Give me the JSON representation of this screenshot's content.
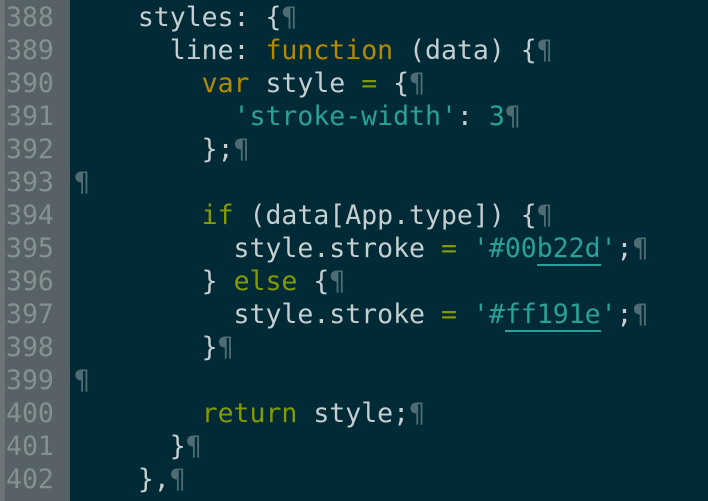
{
  "editor": {
    "pilcrow": "¶",
    "lines": [
      {
        "num": "388",
        "indent": "    ",
        "tokens": [
          [
            "plain",
            "styles: {"
          ]
        ]
      },
      {
        "num": "389",
        "indent": "      ",
        "tokens": [
          [
            "plain",
            "line: "
          ],
          [
            "fn",
            "function"
          ],
          [
            "plain",
            " (data) {"
          ]
        ]
      },
      {
        "num": "390",
        "indent": "        ",
        "tokens": [
          [
            "fn",
            "var"
          ],
          [
            "plain",
            " style "
          ],
          [
            "op",
            "="
          ],
          [
            "plain",
            " {"
          ]
        ]
      },
      {
        "num": "391",
        "indent": "          ",
        "tokens": [
          [
            "str",
            "'stroke-width'"
          ],
          [
            "plain",
            ": "
          ],
          [
            "num",
            "3"
          ]
        ]
      },
      {
        "num": "392",
        "indent": "        ",
        "tokens": [
          [
            "plain",
            "};"
          ]
        ]
      },
      {
        "num": "393",
        "indent": "",
        "tokens": []
      },
      {
        "num": "394",
        "indent": "        ",
        "tokens": [
          [
            "kw",
            "if"
          ],
          [
            "plain",
            " (data[App.type]) {"
          ]
        ]
      },
      {
        "num": "395",
        "indent": "          ",
        "tokens": [
          [
            "plain",
            "style.stroke "
          ],
          [
            "op",
            "="
          ],
          [
            "plain",
            " "
          ],
          [
            "str",
            "'#00"
          ],
          [
            "strU",
            "b22d"
          ],
          [
            "str",
            "'"
          ],
          [
            "plain",
            ";"
          ]
        ]
      },
      {
        "num": "396",
        "indent": "        ",
        "tokens": [
          [
            "plain",
            "} "
          ],
          [
            "kw",
            "else"
          ],
          [
            "plain",
            " {"
          ]
        ]
      },
      {
        "num": "397",
        "indent": "          ",
        "tokens": [
          [
            "plain",
            "style.stroke "
          ],
          [
            "op",
            "="
          ],
          [
            "plain",
            " "
          ],
          [
            "str",
            "'#"
          ],
          [
            "strU",
            "ff191e"
          ],
          [
            "str",
            "'"
          ],
          [
            "plain",
            ";"
          ]
        ]
      },
      {
        "num": "398",
        "indent": "        ",
        "tokens": [
          [
            "plain",
            "}"
          ]
        ]
      },
      {
        "num": "399",
        "indent": "",
        "tokens": []
      },
      {
        "num": "400",
        "indent": "        ",
        "tokens": [
          [
            "kw",
            "return"
          ],
          [
            "plain",
            " style;"
          ]
        ]
      },
      {
        "num": "401",
        "indent": "      ",
        "tokens": [
          [
            "plain",
            "}"
          ]
        ]
      },
      {
        "num": "402",
        "indent": "    ",
        "tokens": [
          [
            "plain",
            "},"
          ]
        ]
      }
    ]
  }
}
